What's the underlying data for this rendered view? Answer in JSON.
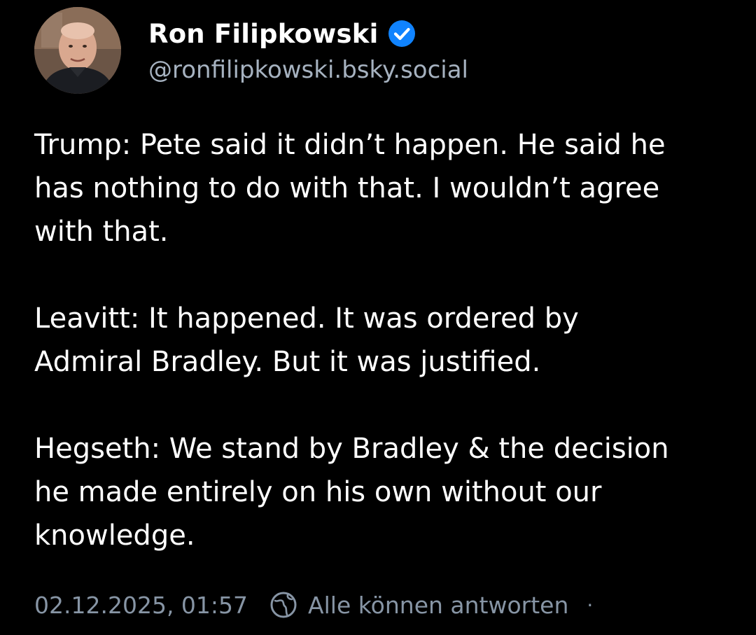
{
  "post": {
    "author": {
      "display_name": "Ron Filipkowski",
      "handle": "@ronfilipkowski.bsky.social",
      "verified": true,
      "verified_icon": "verified-check-icon",
      "avatar_icon": "avatar"
    },
    "body": {
      "paragraph_1": "Trump: Pete said it didn’t happen. He said he\nhas nothing to do with that. I wouldn’t agree\nwith that.",
      "paragraph_2": "Leavitt: It happened. It was ordered by\nAdmiral Bradley. But it was justified.",
      "paragraph_3": "Hegseth: We stand by Bradley & the decision\nhe made entirely on his own without our\nknowledge."
    },
    "meta": {
      "timestamp": "02.12.2025, 01:57",
      "reply_setting_icon": "globe-icon",
      "reply_setting": "Alle können antworten",
      "separator": "·"
    }
  },
  "colors": {
    "background": "#000000",
    "text_primary": "#ffffff",
    "text_secondary": "#8795a5",
    "verified_badge": "#1083fe"
  }
}
